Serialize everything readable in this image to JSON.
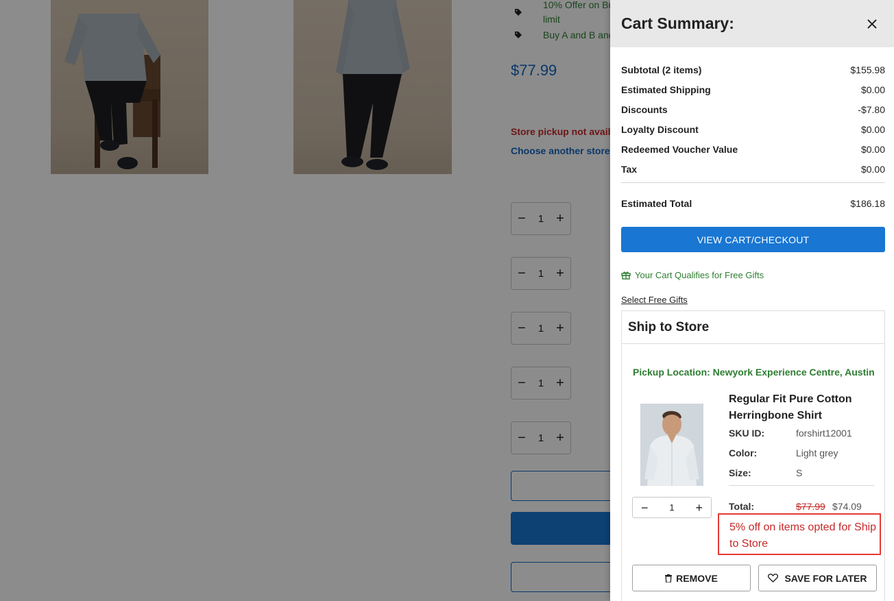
{
  "background_page": {
    "promo_lines": [
      "10% Offer on Bu",
      "limit",
      "Buy A and B and"
    ],
    "price": "$77.99",
    "pickup_status": "Store pickup not availa",
    "choose_store_link": "Choose another store",
    "quantity_steppers": [
      "1",
      "1",
      "1",
      "1",
      "1"
    ]
  },
  "drawer": {
    "title": "Cart Summary:",
    "summary_rows": [
      {
        "label": "Subtotal (2 items)",
        "value": "$155.98"
      },
      {
        "label": "Estimated Shipping",
        "value": "$0.00"
      },
      {
        "label": "Discounts",
        "value": "-$7.80"
      },
      {
        "label": "Loyalty Discount",
        "value": "$0.00"
      },
      {
        "label": "Redeemed Voucher Value",
        "value": "$0.00"
      },
      {
        "label": "Tax",
        "value": "$0.00"
      }
    ],
    "estimated_total": {
      "label": "Estimated Total",
      "value": "$186.18"
    },
    "checkout_button": "VIEW CART/CHECKOUT",
    "free_gift_message": "Your Cart Qualifies for Free Gifts",
    "select_gifts_link": "Select Free Gifts",
    "ship_to_store": {
      "heading": "Ship to Store",
      "pickup_location": "Pickup Location: Newyork Experience Centre, Austin",
      "item": {
        "name": "Regular Fit Pure Cotton Herringbone Shirt",
        "sku_label": "SKU ID:",
        "sku_value": "forshirt12001",
        "color_label": "Color:",
        "color_value": "Light grey",
        "size_label": "Size:",
        "size_value": "S",
        "quantity": "1",
        "total_label": "Total:",
        "original_price": "$77.99",
        "discounted_price": "$74.09",
        "offer_note": "5% off on items opted for Ship to Store"
      },
      "remove_button": "REMOVE",
      "save_for_later_button": "SAVE FOR LATER"
    }
  },
  "colors": {
    "accent_blue": "#1976d2",
    "price_blue": "#1565c0",
    "success_green": "#2e7d32",
    "error_red": "#c62828",
    "highlight_border": "#e53935"
  }
}
